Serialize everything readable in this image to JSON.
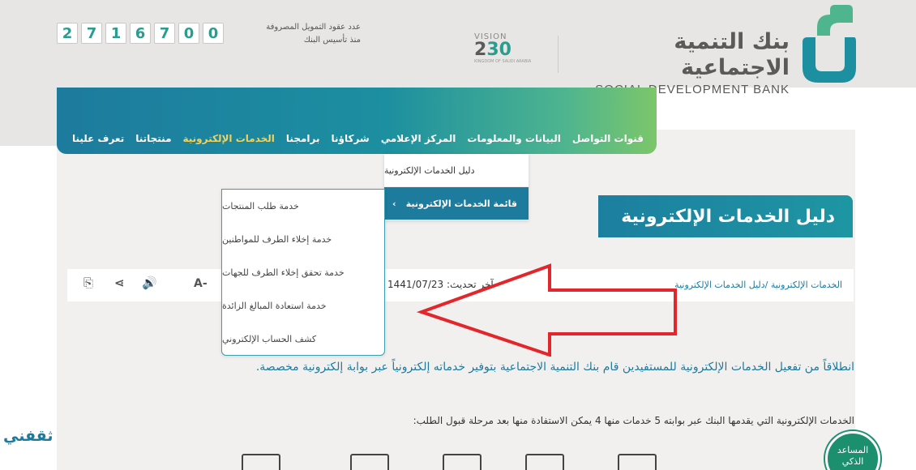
{
  "header": {
    "counter_caption_line1": "عدد عقود التمويل المصروفة",
    "counter_caption_line2": "منذ تأسيس البنك",
    "counter_digits": [
      "2",
      "7",
      "1",
      "6",
      "7",
      "0",
      "0"
    ],
    "vision_top": "VISION",
    "vision_year_a": "2",
    "vision_year_b": "30",
    "vision_sub": "KINGDOM OF SAUDI ARABIA",
    "bank_name_ar": "بنك التنمية الاجتماعية",
    "bank_name_en": "SOCIAL DEVELOPMENT BANK"
  },
  "nav": {
    "items": [
      {
        "label": "تعرف علينا"
      },
      {
        "label": "منتجاتنا"
      },
      {
        "label": "الخدمات الإلكترونية",
        "active": true
      },
      {
        "label": "برامجنا"
      },
      {
        "label": "شركاؤنا"
      },
      {
        "label": "المركز الإعلامي"
      },
      {
        "label": "البيانات والمعلومات"
      },
      {
        "label": "قنوات التواصل"
      }
    ]
  },
  "dropdown1": {
    "items": [
      {
        "label": "دليل الخدمات الإلكترونية"
      },
      {
        "label": "قائمة الخدمات الإلكترونية",
        "selected": true
      }
    ],
    "chevron": "‹"
  },
  "dropdown2": {
    "items": [
      {
        "label": "خدمة طلب المنتجات"
      },
      {
        "label": "خدمة إخلاء الطرف للمواطنين"
      },
      {
        "label": "خدمة تحقق إخلاء الطرف للجهات"
      },
      {
        "label": "خدمة استعادة المبالغ الزائدة"
      },
      {
        "label": "كشف الحساب الإلكتروني"
      }
    ]
  },
  "page": {
    "title": "دليل الخدمات الإلكترونية",
    "breadcrumb": "الخدمات الإلكترونية /دليل الخدمات الإلكترونية",
    "updated": "آخر تحديث: 1441/07/23",
    "font_decrease": "A-",
    "intro": "انطلاقاً من تفعيل الخدمات الإلكترونية للمستفيدين قام بنك التنمية الاجتماعية بتوفير خدماته إلكترونياً عبر بوابة إلكترونية مخصصة.",
    "sub": "الخدمات الإلكترونية التي يقدمها البنك عبر بوابته 5 خدمات منها 4 يمكن الاستفادة منها بعد مرحلة قبول الطلب:"
  },
  "tools": {
    "print_icon": "⎘",
    "share_icon": "⋖",
    "audio_icon": "🔊"
  },
  "watermark": "ثقفني",
  "assistant": {
    "line1": "المساعد",
    "line2": "الذكي"
  },
  "colors": {
    "teal": "#1d7b9e",
    "green": "#7cc66a",
    "active_nav": "#f3d25c",
    "arrow": "#e3262b"
  }
}
